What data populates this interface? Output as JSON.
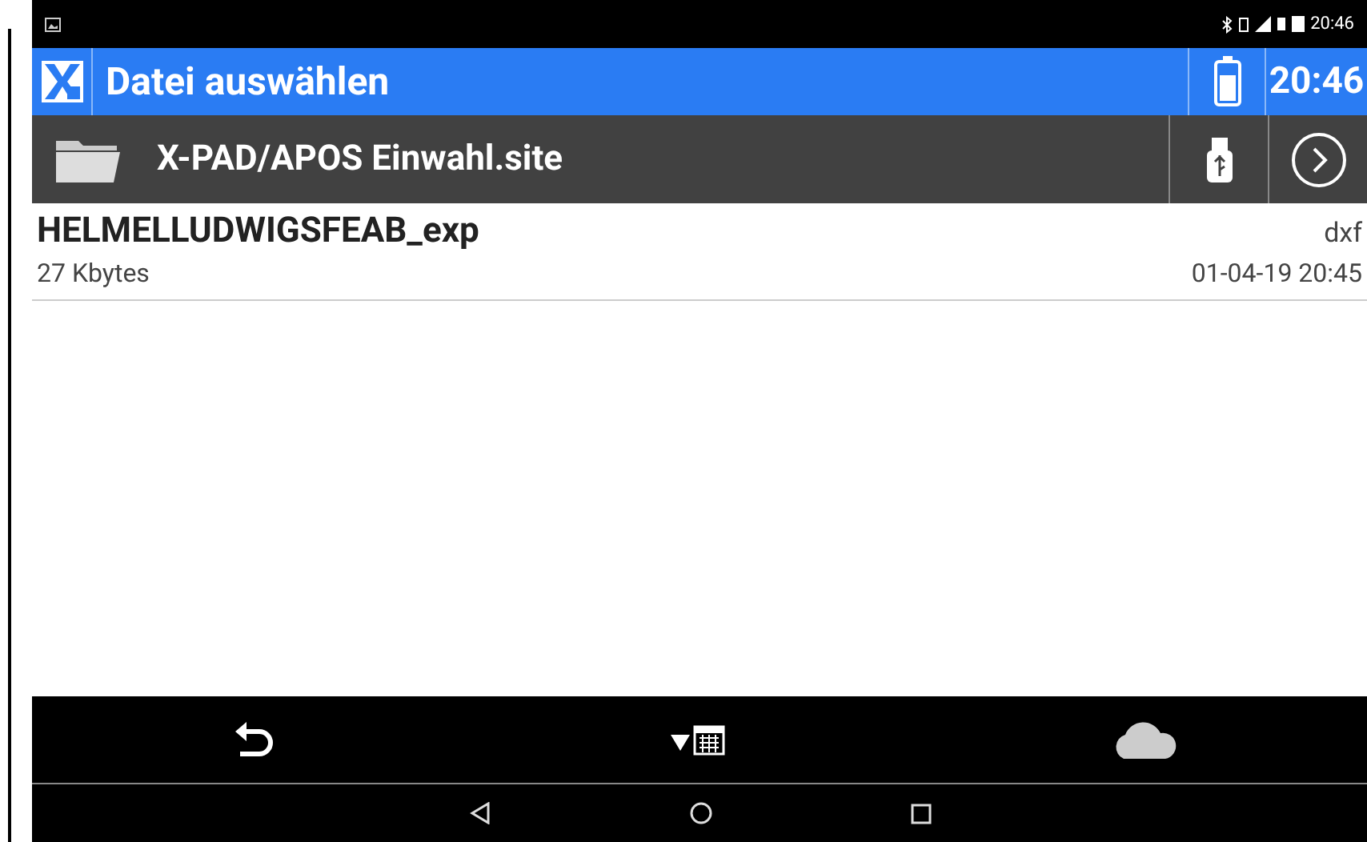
{
  "status_bar": {
    "time": "20:46"
  },
  "title_bar": {
    "title": "Datei auswählen",
    "time": "20:46"
  },
  "path_bar": {
    "path": "X-PAD/APOS Einwahl.site"
  },
  "files": [
    {
      "name": "HELMELLUDWIGSFEAB_exp",
      "type": "dxf",
      "size": "27 Kbytes",
      "date": "01-04-19 20:45"
    }
  ]
}
